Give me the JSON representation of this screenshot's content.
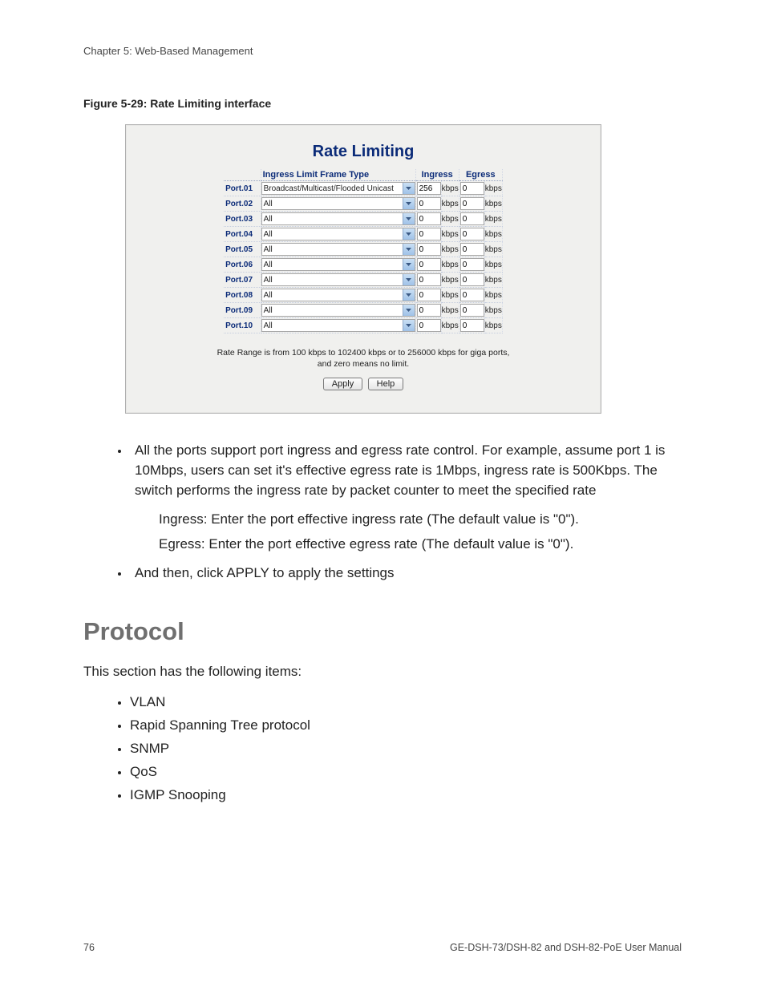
{
  "chapter": "Chapter 5: Web-Based Management",
  "figure_caption": "Figure 5-29:  Rate Limiting interface",
  "panel": {
    "title": "Rate Limiting",
    "headers": {
      "frame_type": "Ingress Limit Frame Type",
      "ingress": "Ingress",
      "egress": "Egress"
    },
    "kbps": "kbps",
    "ports": [
      {
        "name": "Port.01",
        "frame_type": "Broadcast/Multicast/Flooded Unicast",
        "ingress": "256",
        "egress": "0"
      },
      {
        "name": "Port.02",
        "frame_type": "All",
        "ingress": "0",
        "egress": "0"
      },
      {
        "name": "Port.03",
        "frame_type": "All",
        "ingress": "0",
        "egress": "0"
      },
      {
        "name": "Port.04",
        "frame_type": "All",
        "ingress": "0",
        "egress": "0"
      },
      {
        "name": "Port.05",
        "frame_type": "All",
        "ingress": "0",
        "egress": "0"
      },
      {
        "name": "Port.06",
        "frame_type": "All",
        "ingress": "0",
        "egress": "0"
      },
      {
        "name": "Port.07",
        "frame_type": "All",
        "ingress": "0",
        "egress": "0"
      },
      {
        "name": "Port.08",
        "frame_type": "All",
        "ingress": "0",
        "egress": "0"
      },
      {
        "name": "Port.09",
        "frame_type": "All",
        "ingress": "0",
        "egress": "0"
      },
      {
        "name": "Port.10",
        "frame_type": "All",
        "ingress": "0",
        "egress": "0"
      }
    ],
    "note_line1": "Rate Range is from 100 kbps to 102400 kbps or to 256000 kbps for giga ports,",
    "note_line2": "and zero means no limit.",
    "apply": "Apply",
    "help": "Help"
  },
  "body": {
    "bullet1": "All the ports support port ingress and egress rate control. For example, assume port 1 is 10Mbps, users can set it's effective egress rate is 1Mbps, ingress rate is 500Kbps. The switch performs the ingress rate by packet counter to meet the specified rate",
    "ingress_def": "Ingress: Enter the port effective ingress rate (The default value is \"0\").",
    "egress_def": "Egress: Enter the port effective egress rate (The default value is \"0\").",
    "bullet2": "And then, click APPLY to apply the settings"
  },
  "protocol": {
    "heading": "Protocol",
    "intro": "This section has the following items:",
    "items": [
      "VLAN",
      "Rapid Spanning Tree protocol",
      "SNMP",
      "QoS",
      "IGMP Snooping"
    ]
  },
  "footer": {
    "page": "76",
    "doc": "GE-DSH-73/DSH-82 and DSH-82-PoE User Manual"
  }
}
